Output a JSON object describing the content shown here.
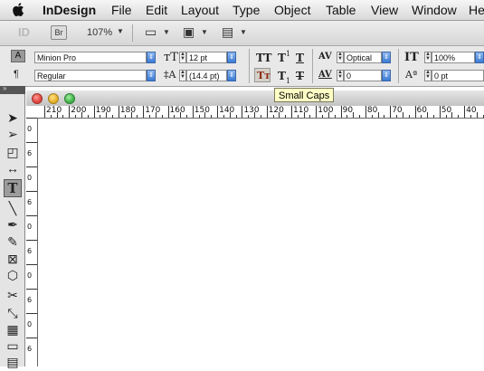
{
  "menubar": {
    "app_name": "InDesign",
    "items": [
      "File",
      "Edit",
      "Layout",
      "Type",
      "Object",
      "Table",
      "View",
      "Window",
      "He"
    ]
  },
  "appbar": {
    "id_logo": "ID",
    "bridge_label": "Br",
    "zoom": "107%"
  },
  "control": {
    "char_mode_icon": "A",
    "para_mode_icon": "¶",
    "font_family": "Minion Pro",
    "font_style": "Regular",
    "font_size": "12 pt",
    "leading": "(14.4 pt)",
    "kerning": "Optical",
    "tracking": "0",
    "vertical_scale": "100%",
    "baseline_shift": "0 pt",
    "tt_all_caps": "TT",
    "tt_superscript": "T",
    "tt_underline": "T",
    "tt_small_caps": "Tт",
    "tt_subscript": "T",
    "tt_strikethrough": "T"
  },
  "tooltip": "Small Caps",
  "ruler": {
    "horizontal": [
      "210",
      "200",
      "190",
      "180",
      "170",
      "160",
      "150",
      "140",
      "130",
      "120",
      "110",
      "100",
      "90",
      "80",
      "70",
      "60",
      "50",
      "40"
    ],
    "vertical": [
      "0",
      "6",
      "0",
      "6",
      "0",
      "6",
      "0",
      "6",
      "0",
      "6"
    ]
  },
  "tools": [
    {
      "name": "selection-tool-icon",
      "glyph": "➤"
    },
    {
      "name": "direct-selection-tool-icon",
      "glyph": "➢"
    },
    {
      "name": "page-tool-icon",
      "glyph": "◰"
    },
    {
      "name": "gap-tool-icon",
      "glyph": "↔"
    },
    {
      "name": "type-tool-icon",
      "glyph": "T"
    },
    {
      "name": "line-tool-icon",
      "glyph": "╲"
    },
    {
      "name": "pen-tool-icon",
      "glyph": "✒"
    },
    {
      "name": "pencil-tool-icon",
      "glyph": "✎"
    },
    {
      "name": "rectangle-frame-tool-icon",
      "glyph": "⊠"
    },
    {
      "name": "polygon-tool-icon",
      "glyph": "⬡"
    },
    {
      "name": "scissors-tool-icon",
      "glyph": "✂"
    },
    {
      "name": "free-transform-tool-icon",
      "glyph": "⤡"
    },
    {
      "name": "gradient-tool-icon",
      "glyph": "▦"
    },
    {
      "name": "note-tool-icon",
      "glyph": "▭"
    },
    {
      "name": "eyedropper-tool-icon",
      "glyph": "▤"
    }
  ],
  "colors": {
    "dropdown_blue": "#3a7bd5",
    "close_red": "#e0443e",
    "minimize_yellow": "#e6b12a",
    "zoom_green": "#3fb34a",
    "tooltip_bg": "#ffffc6"
  }
}
